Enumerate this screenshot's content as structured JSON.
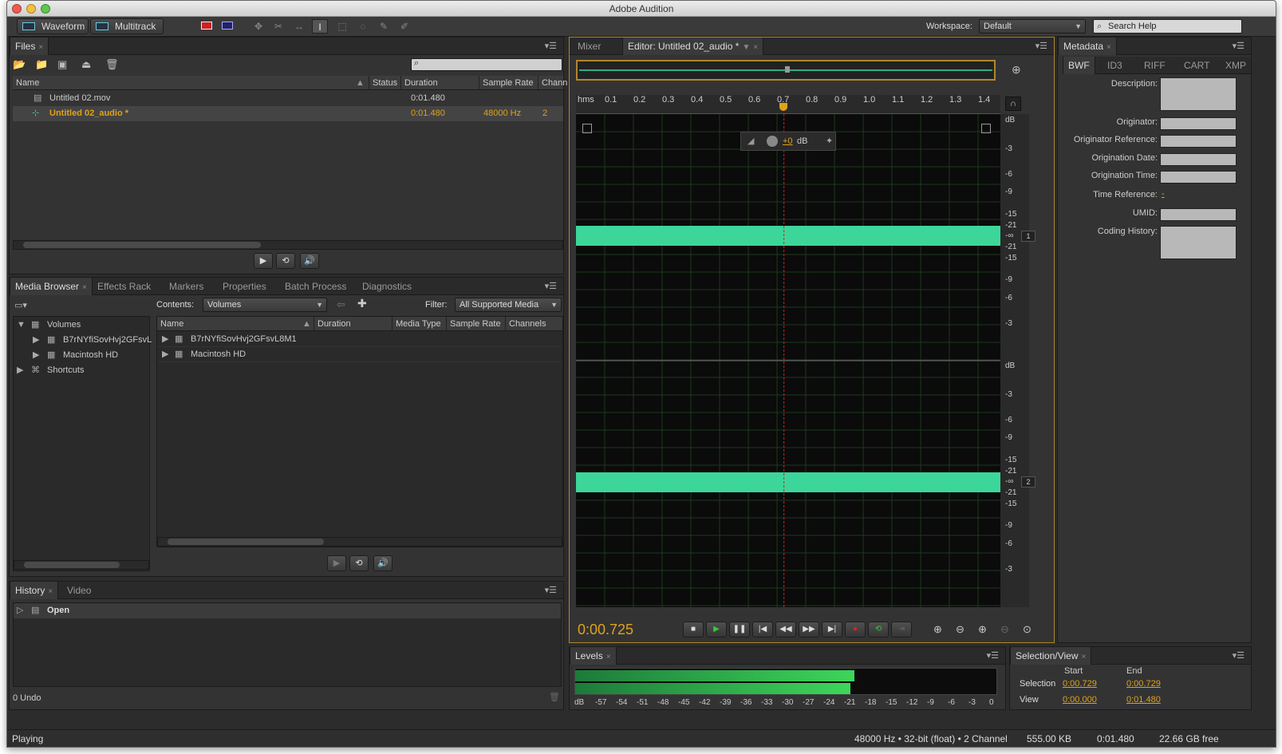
{
  "app": {
    "title": "Adobe Audition"
  },
  "toolbar": {
    "waveform": "Waveform",
    "multitrack": "Multitrack",
    "workspace_label": "Workspace:",
    "workspace_value": "Default",
    "search_placeholder": "Search Help"
  },
  "files": {
    "tab": "Files",
    "columns": [
      "Name",
      "Status",
      "Duration",
      "Sample Rate",
      "Chann"
    ],
    "rows": [
      {
        "name": "Untitled 02.mov",
        "status": "",
        "duration": "0:01.480",
        "rate": "",
        "channels": ""
      },
      {
        "name": "Untitled 02_audio *",
        "status": "",
        "duration": "0:01.480",
        "rate": "48000 Hz",
        "channels": "2"
      }
    ]
  },
  "media": {
    "tabs": [
      "Media Browser",
      "Effects Rack",
      "Markers",
      "Properties",
      "Batch Process",
      "Diagnostics"
    ],
    "contents_label": "Contents:",
    "contents_value": "Volumes",
    "filter_label": "Filter:",
    "filter_value": "All Supported Media",
    "tree": [
      "Volumes",
      "B7rNYfiSovHvj2GFsvL",
      "Macintosh HD",
      "Shortcuts"
    ],
    "columns": [
      "Name",
      "Duration",
      "Media Type",
      "Sample Rate",
      "Channels"
    ],
    "rows": [
      "B7rNYfiSovHvj2GFsvL8M1",
      "Macintosh HD"
    ]
  },
  "history": {
    "tabs": [
      "History",
      "Video"
    ],
    "item": "Open",
    "undo": "0 Undo"
  },
  "editor": {
    "tabs": [
      "Mixer",
      "Editor: Untitled 02_audio *"
    ],
    "ruler_unit": "hms",
    "ruler": [
      "0.1",
      "0.2",
      "0.3",
      "0.4",
      "0.5",
      "0.6",
      "0.7",
      "0.8",
      "0.9",
      "1.0",
      "1.1",
      "1.2",
      "1.3",
      "1.4"
    ],
    "db_labels": [
      "dB",
      "-3",
      "-6",
      "-9",
      "-15",
      "-21",
      "-∞",
      "-21",
      "-15",
      "-9",
      "-6",
      "-3"
    ],
    "hud_gain": "+0",
    "hud_unit": "dB",
    "channels": [
      "1",
      "2"
    ],
    "playhead_fraction": 0.49,
    "time": "0:00.725"
  },
  "metadata": {
    "tab": "Metadata",
    "subtabs": [
      "BWF",
      "ID3",
      "RIFF",
      "CART",
      "XMP"
    ],
    "fields": [
      "Description:",
      "Originator:",
      "Originator Reference:",
      "Origination Date:",
      "Origination Time:",
      "Time Reference:",
      "UMID:",
      "Coding History:"
    ],
    "time_reference_value": "-"
  },
  "levels": {
    "tab": "Levels",
    "scale": [
      "dB",
      "-57",
      "-54",
      "-51",
      "-48",
      "-45",
      "-42",
      "-39",
      "-36",
      "-33",
      "-30",
      "-27",
      "-24",
      "-21",
      "-18",
      "-15",
      "-12",
      "-9",
      "-6",
      "-3",
      "0"
    ],
    "level_left": 0.66,
    "level_right": 0.65
  },
  "selection": {
    "tab": "Selection/View",
    "start_label": "Start",
    "end_label": "End",
    "selection_label": "Selection",
    "view_label": "View",
    "sel_start": "0:00.729",
    "sel_end": "0:00.729",
    "view_start": "0:00.000",
    "view_end": "0:01.480"
  },
  "status": {
    "left": "Playing",
    "format": "48000 Hz • 32-bit (float) • 2 Channel",
    "size": "555.00 KB",
    "duration": "0:01.480",
    "free": "22.66 GB free"
  },
  "colors": {
    "waveform": "#3dd69a",
    "accent": "#e0a21a",
    "playhead": "#d02020"
  }
}
